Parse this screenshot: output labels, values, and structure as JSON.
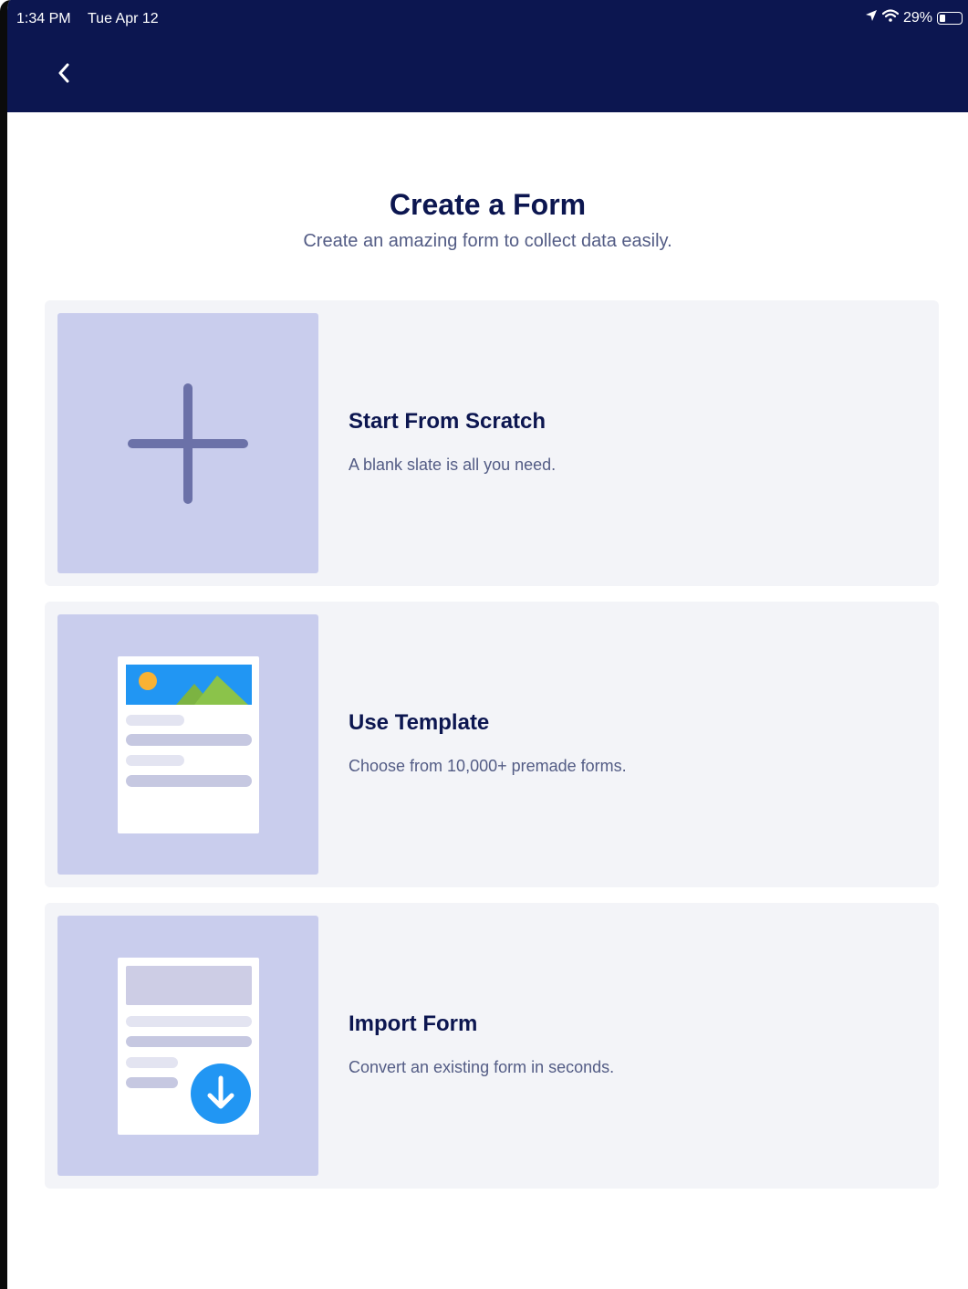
{
  "status_bar": {
    "time": "1:34 PM",
    "date": "Tue Apr 12",
    "battery": "29%",
    "battery_level": 0.29
  },
  "header": {
    "back_icon": "chevron-left-icon"
  },
  "page": {
    "title": "Create a Form",
    "subtitle": "Create an amazing form to collect data easily."
  },
  "options": [
    {
      "title": "Start From Scratch",
      "description": "A blank slate is all you need.",
      "icon": "plus-icon"
    },
    {
      "title": "Use Template",
      "description": "Choose from 10,000+ premade forms.",
      "icon": "template-form-icon"
    },
    {
      "title": "Import Form",
      "description": "Convert an existing form in seconds.",
      "icon": "import-form-icon"
    }
  ],
  "colors": {
    "header_bg": "#0c1650",
    "title": "#0c1650",
    "subtitle": "#535c85",
    "card_bg": "#f3f4f8",
    "thumb_bg": "#c9cded",
    "accent_blue": "#2196f3"
  }
}
